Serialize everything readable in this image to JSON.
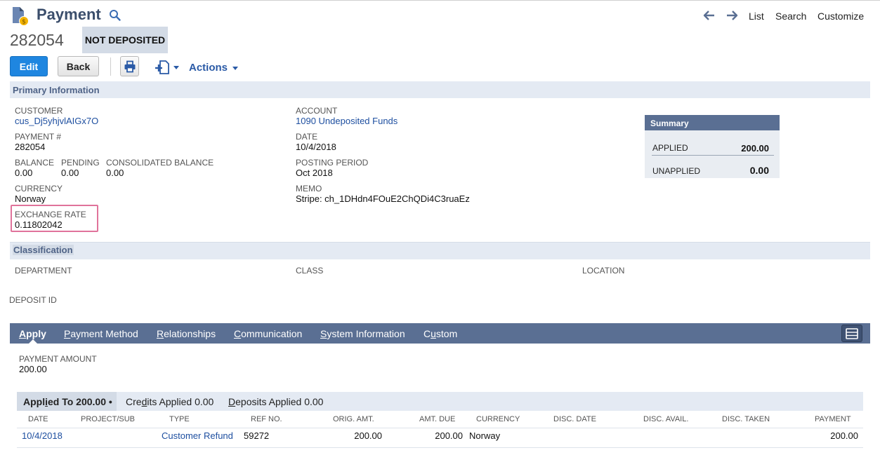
{
  "header": {
    "title": "Payment",
    "record_number": "282054",
    "status": "NOT DEPOSITED",
    "top_links": [
      "List",
      "Search",
      "Customize"
    ]
  },
  "toolbar": {
    "edit_label": "Edit",
    "back_label": "Back",
    "actions_label": "Actions"
  },
  "primary": {
    "section_title": "Primary Information",
    "customer_label": "CUSTOMER",
    "customer_value": "cus_Dj5yhjvlAIGx7O",
    "payment_num_label": "PAYMENT #",
    "payment_num_value": "282054",
    "balance_label": "BALANCE",
    "balance_value": "0.00",
    "pending_label": "PENDING",
    "pending_value": "0.00",
    "consolidated_label": "CONSOLIDATED BALANCE",
    "consolidated_value": "0.00",
    "currency_label": "CURRENCY",
    "currency_value": "Norway",
    "exchange_label": "EXCHANGE RATE",
    "exchange_value": "0.11802042",
    "account_label": "ACCOUNT",
    "account_value": "1090 Undeposited Funds",
    "date_label": "DATE",
    "date_value": "10/4/2018",
    "posting_label": "POSTING PERIOD",
    "posting_value": "Oct 2018",
    "memo_label": "MEMO",
    "memo_value": "Stripe: ch_1DHdn4FOuE2ChQDi4C3ruaEz"
  },
  "summary": {
    "title": "Summary",
    "applied_label": "APPLIED",
    "applied_value": "200.00",
    "unapplied_label": "UNAPPLIED",
    "unapplied_value": "0.00"
  },
  "classification": {
    "section_title": "Classification",
    "department_label": "DEPARTMENT",
    "class_label": "CLASS",
    "location_label": "LOCATION",
    "deposit_id_label": "DEPOSIT ID"
  },
  "tabs": {
    "apply": {
      "prefix": "",
      "underlined": "A",
      "rest": "pply"
    },
    "payment_method": {
      "prefix": "",
      "underlined": "P",
      "rest": "ayment Method"
    },
    "relationships": {
      "prefix": "",
      "underlined": "R",
      "rest": "elationships"
    },
    "communication": {
      "prefix": "",
      "underlined": "C",
      "rest": "ommunication"
    },
    "system_information": {
      "prefix": "",
      "underlined": "S",
      "rest": "ystem Information"
    },
    "custom": {
      "prefix": "C",
      "underlined": "u",
      "rest": "stom"
    }
  },
  "apply": {
    "payment_amount_label": "PAYMENT AMOUNT",
    "payment_amount_value": "200.00",
    "subtabs": {
      "applied": {
        "prefix": "Appl",
        "underlined": "i",
        "rest": "ed To 200.00 •"
      },
      "credits": {
        "prefix": "Cre",
        "underlined": "d",
        "rest": "its Applied 0.00"
      },
      "deposits": {
        "prefix": "",
        "underlined": "D",
        "rest": "eposits Applied 0.00"
      }
    },
    "columns": [
      "DATE",
      "PROJECT/SUB",
      "TYPE",
      "REF NO.",
      "ORIG. AMT.",
      "AMT. DUE",
      "CURRENCY",
      "DISC. DATE",
      "DISC. AVAIL.",
      "DISC. TAKEN",
      "PAYMENT"
    ],
    "rows": [
      {
        "date": "10/4/2018",
        "project": "",
        "type": "Customer Refund",
        "ref_no": "59272",
        "orig_amt": "200.00",
        "amt_due": "200.00",
        "currency": "Norway",
        "disc_date": "",
        "disc_avail": "",
        "disc_taken": "",
        "payment": "200.00"
      }
    ]
  },
  "colors": {
    "accent": "#1f86e0",
    "section_bg": "#e4eaf3",
    "tab_bar": "#5a6f93",
    "link": "#1e4fa0",
    "highlight": "#e0739b"
  }
}
